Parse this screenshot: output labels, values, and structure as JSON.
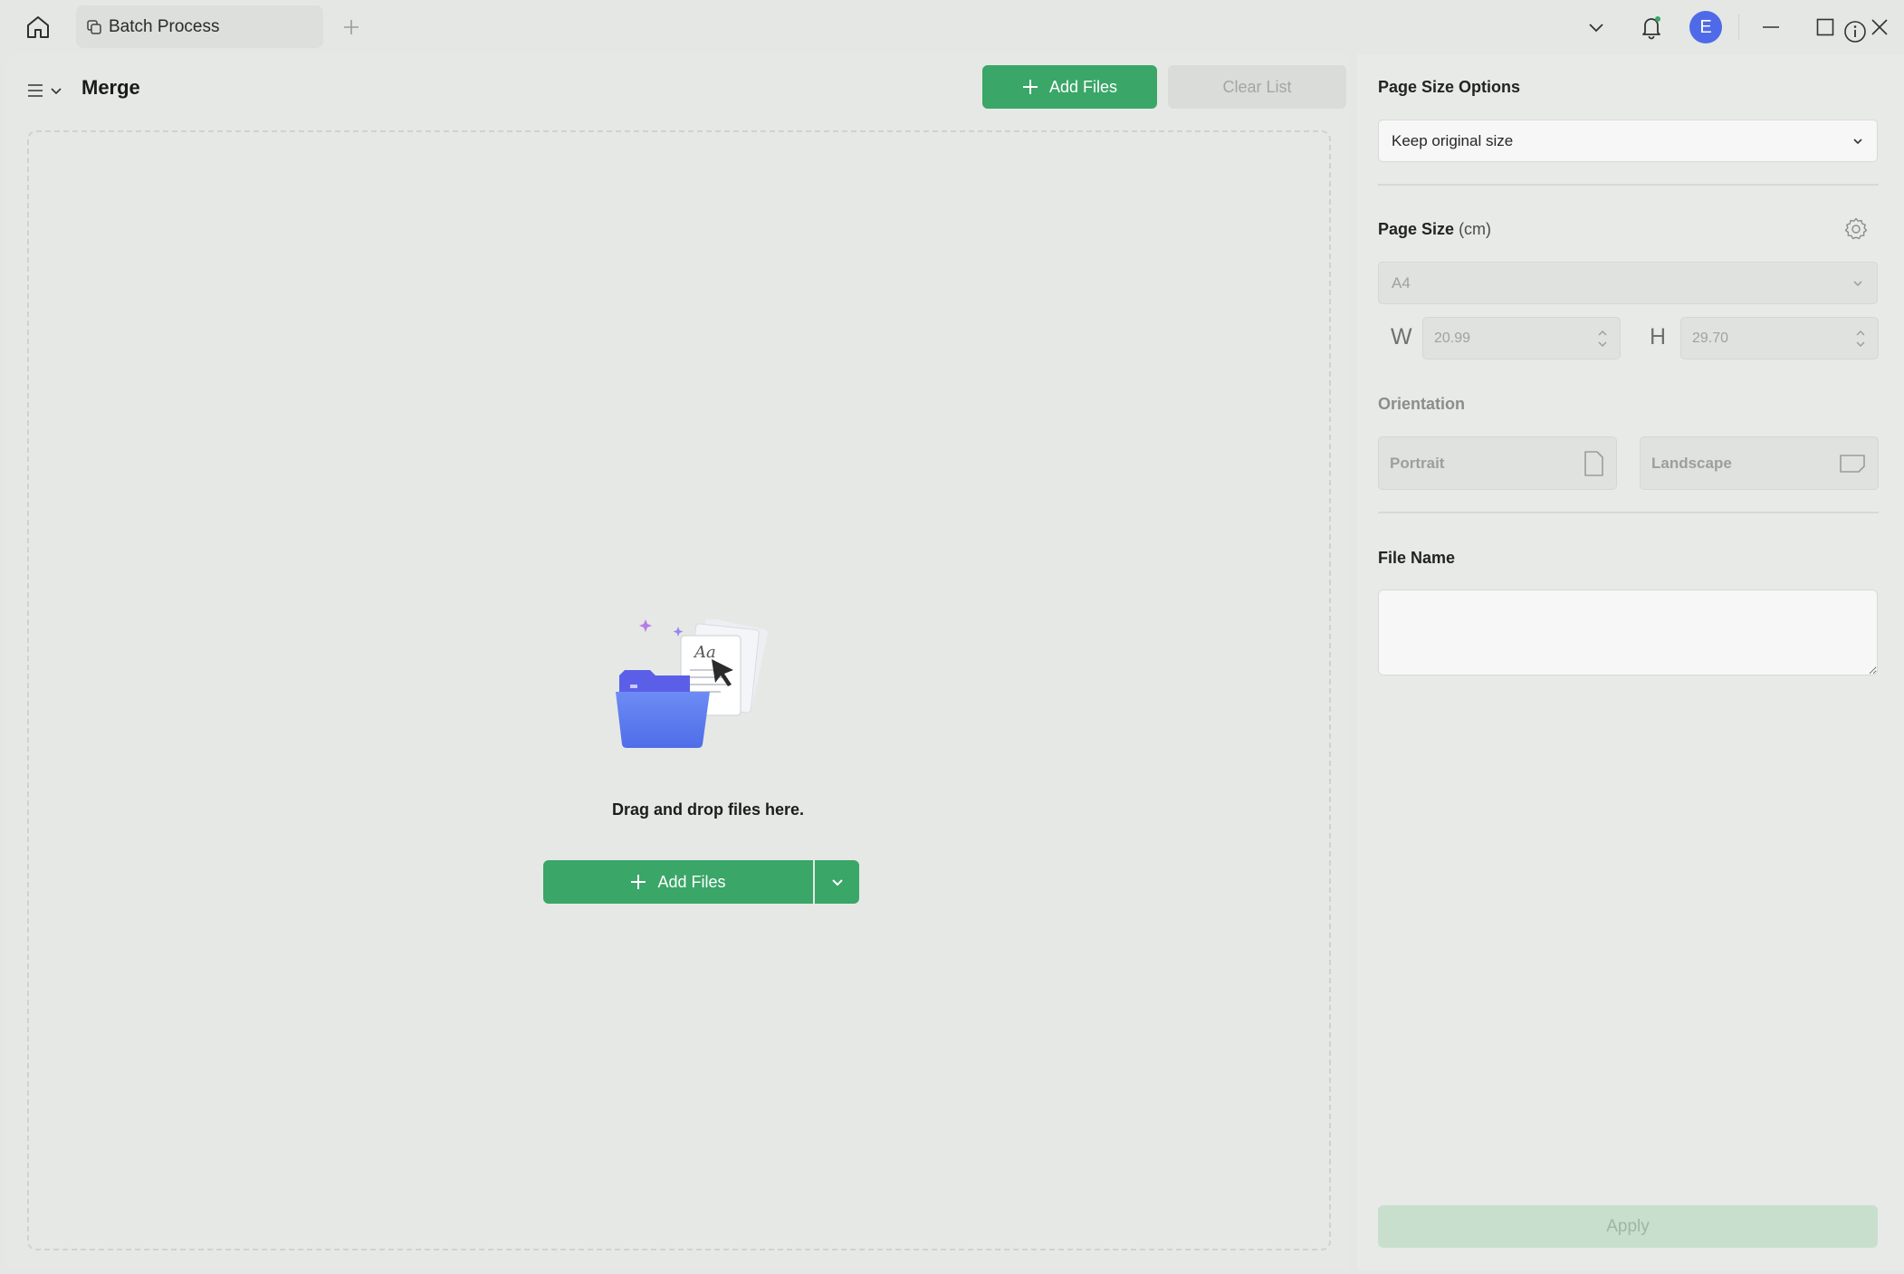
{
  "titlebar": {
    "tab_label": "Batch Process",
    "avatar_initial": "E"
  },
  "toolbar": {
    "title": "Merge",
    "add_files_label": "Add Files",
    "clear_list_label": "Clear List"
  },
  "dropzone": {
    "text": "Drag and drop files here.",
    "add_files_label": "Add Files"
  },
  "settings": {
    "page_size_options_label": "Page Size Options",
    "page_size_option_value": "Keep original size",
    "page_size_label": "Page Size",
    "page_size_unit": "(cm)",
    "paper_value": "A4",
    "width_letter": "W",
    "width_value": "20.99",
    "height_letter": "H",
    "height_value": "29.70",
    "orientation_label": "Orientation",
    "portrait_label": "Portrait",
    "landscape_label": "Landscape",
    "file_name_label": "File Name",
    "file_name_value": "",
    "apply_label": "Apply"
  },
  "colors": {
    "accent": "#3aa667",
    "avatar": "#4f6ae8",
    "apply_disabled": "#c8dfce"
  },
  "icons": {
    "home": "home-icon",
    "batch": "batch-process-icon",
    "new_tab": "plus-icon",
    "dropdown": "chevron-down-icon",
    "notification": "bell-icon",
    "minimize": "minimize-icon",
    "maximize": "maximize-icon",
    "close": "close-icon",
    "menu": "hamburger-icon",
    "info": "info-icon",
    "settings": "gear-icon",
    "portrait": "portrait-page-icon",
    "landscape": "landscape-page-icon"
  }
}
